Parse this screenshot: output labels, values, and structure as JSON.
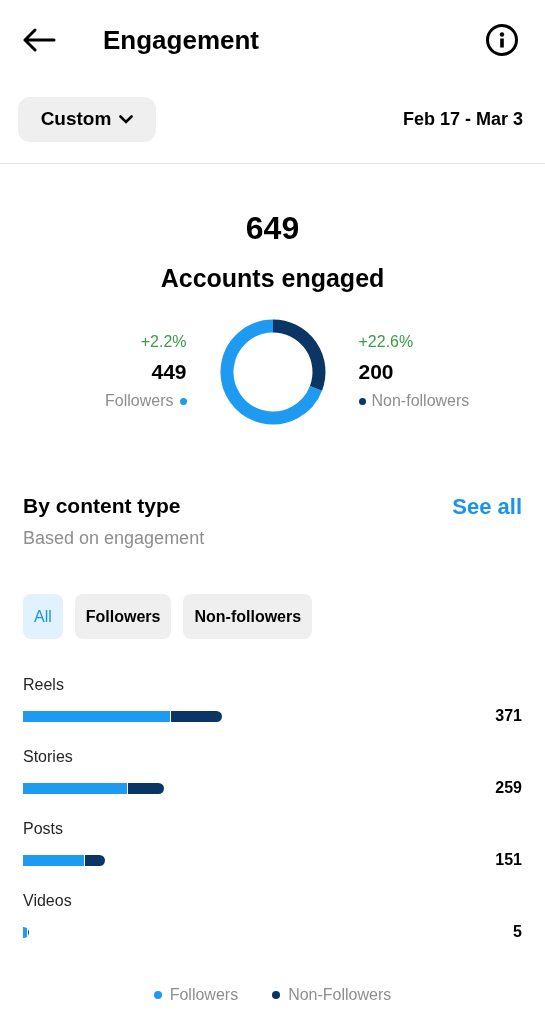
{
  "header": {
    "title": "Engagement"
  },
  "range": {
    "preset": "Custom",
    "dates": "Feb 17 - Mar 3"
  },
  "summary": {
    "total": "649",
    "label": "Accounts engaged",
    "stats": [
      {
        "change": "+2.2%",
        "value": "449",
        "label": "Followers",
        "color": "#1e9af0"
      },
      {
        "change": "+22.6%",
        "value": "200",
        "label": "Non-followers",
        "color": "#0b3564"
      }
    ]
  },
  "content_type": {
    "title": "By content type",
    "subtitle": "Based on engagement",
    "link": "See all",
    "filters": [
      {
        "label": "All",
        "selected": true
      },
      {
        "label": "Followers",
        "selected": false
      },
      {
        "label": "Non-followers",
        "selected": false
      }
    ],
    "rows": [
      {
        "label": "Reels",
        "value": "371"
      },
      {
        "label": "Stories",
        "value": "259"
      },
      {
        "label": "Posts",
        "value": "151"
      },
      {
        "label": "Videos",
        "value": "5"
      }
    ],
    "legend": [
      {
        "label": "Followers",
        "color": "#1e9af0"
      },
      {
        "label": "Non-Followers",
        "color": "#0b3564"
      }
    ]
  }
}
